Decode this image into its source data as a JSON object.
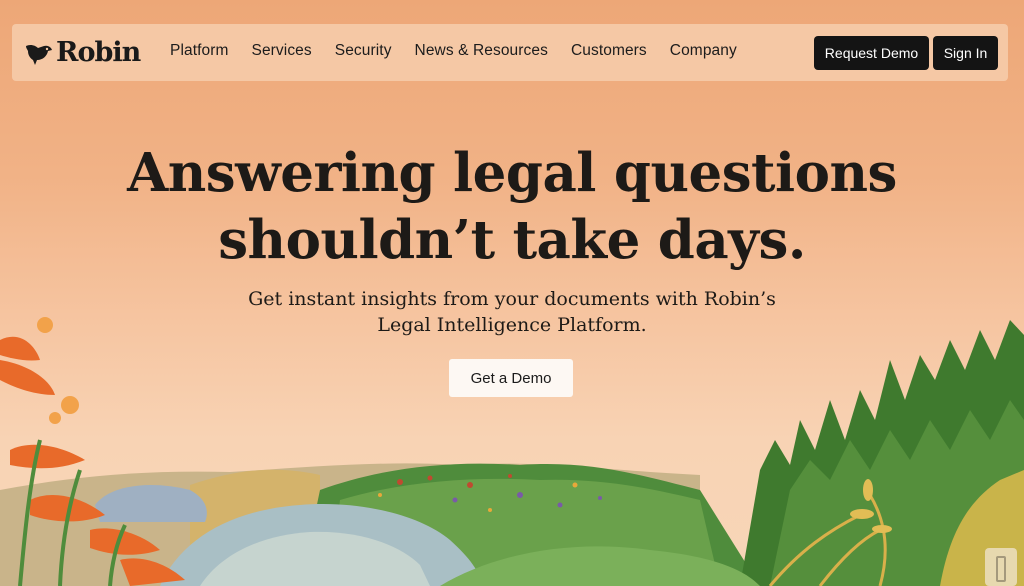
{
  "brand": {
    "name": "Robin",
    "logo_icon": "robin-bird-icon"
  },
  "nav": {
    "links": [
      "Platform",
      "Services",
      "Security",
      "News & Resources",
      "Customers",
      "Company"
    ],
    "request_demo": "Request Demo",
    "sign_in": "Sign In"
  },
  "hero": {
    "title_line1": "Answering legal questions",
    "title_line2": "shouldn’t take days.",
    "subtitle_line1": "Get instant insights from your documents with Robin’s",
    "subtitle_line2": "Legal Intelligence Platform.",
    "cta": "Get a Demo"
  },
  "colors": {
    "background_top": "#eda777",
    "background_bottom": "#f7d6b8",
    "nav_bg": "#f5c8a5",
    "button_dark": "#141414",
    "cta_bg": "#fdf8f3"
  }
}
